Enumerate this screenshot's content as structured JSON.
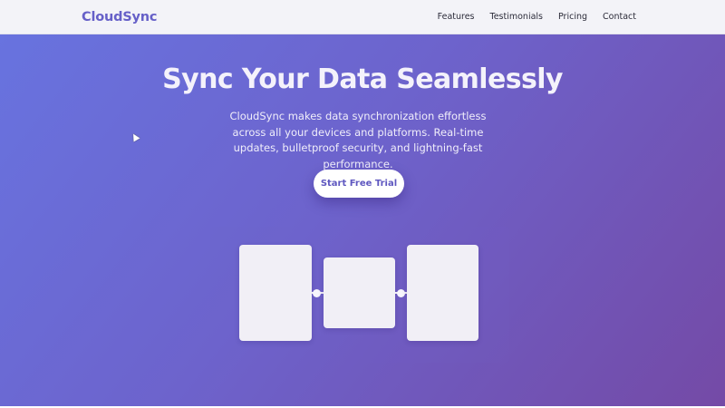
{
  "navbar": {
    "logo": "CloudSync",
    "links": [
      {
        "label": "Features"
      },
      {
        "label": "Testimonials"
      },
      {
        "label": "Pricing"
      },
      {
        "label": "Contact"
      }
    ]
  },
  "hero": {
    "title": "Sync Your Data Seamlessly",
    "description": "CloudSync makes data synchronization effortless across all your devices and platforms. Real-time updates, bulletproof security, and lightning-fast performance.",
    "cta_label": "Start Free Trial"
  },
  "colors": {
    "brand": "#6660c8",
    "gradient_start": "#6873df",
    "gradient_end": "#744aa6",
    "card": "#f1eff6"
  },
  "icons": {
    "cursor": "mouse-pointer-icon"
  }
}
